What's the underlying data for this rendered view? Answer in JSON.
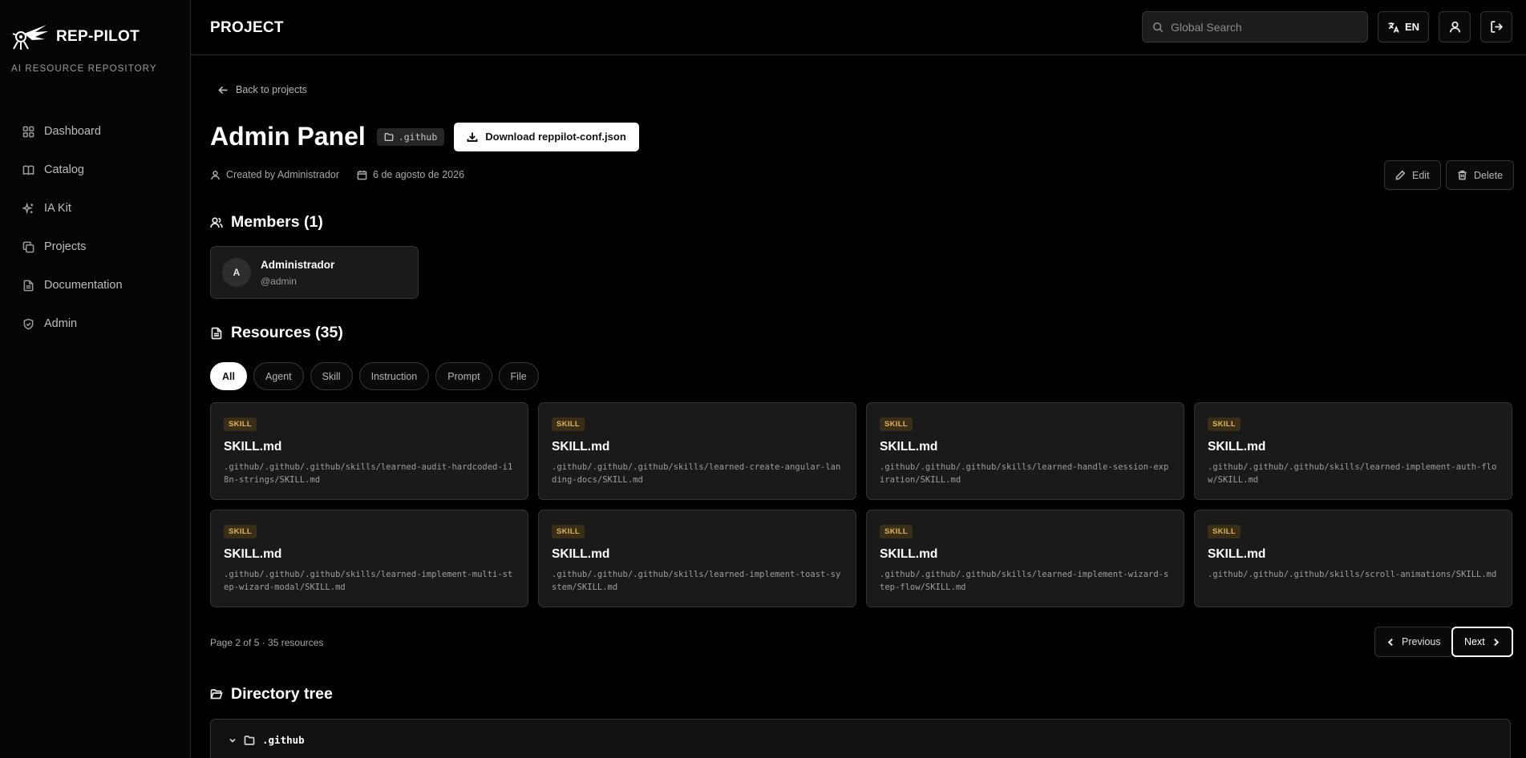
{
  "brand": {
    "name": "REP-PILOT",
    "subtitle": "AI RESOURCE REPOSITORY"
  },
  "sidebar": {
    "items": [
      {
        "label": "Dashboard",
        "icon": "grid-icon"
      },
      {
        "label": "Catalog",
        "icon": "book-icon"
      },
      {
        "label": "IA Kit",
        "icon": "sparkles-icon"
      },
      {
        "label": "Projects",
        "icon": "copy-icon"
      },
      {
        "label": "Documentation",
        "icon": "file-text-icon"
      },
      {
        "label": "Admin",
        "icon": "shield-icon"
      }
    ]
  },
  "header": {
    "title": "PROJECT",
    "search_placeholder": "Global Search",
    "lang": "EN"
  },
  "project": {
    "back_label": "Back to projects",
    "name": "Admin Panel",
    "path": ".github",
    "download_label": "Download reppilot-conf.json",
    "created_by": "Created by Administrador",
    "date": "6 de agosto de 2026",
    "edit_label": "Edit",
    "delete_label": "Delete"
  },
  "members": {
    "heading": "Members (1)",
    "list": [
      {
        "initial": "A",
        "name": "Administrador",
        "handle": "@admin"
      }
    ]
  },
  "resources": {
    "heading": "Resources (35)",
    "filters": [
      "All",
      "Agent",
      "Skill",
      "Instruction",
      "Prompt",
      "File"
    ],
    "active_filter": "All",
    "items": [
      {
        "type": "SKILL",
        "title": "SKILL.md",
        "path": ".github/.github/.github/skills/learned-audit-hardcoded-i18n-strings/SKILL.md"
      },
      {
        "type": "SKILL",
        "title": "SKILL.md",
        "path": ".github/.github/.github/skills/learned-create-angular-landing-docs/SKILL.md"
      },
      {
        "type": "SKILL",
        "title": "SKILL.md",
        "path": ".github/.github/.github/skills/learned-handle-session-expiration/SKILL.md"
      },
      {
        "type": "SKILL",
        "title": "SKILL.md",
        "path": ".github/.github/.github/skills/learned-implement-auth-flow/SKILL.md"
      },
      {
        "type": "SKILL",
        "title": "SKILL.md",
        "path": ".github/.github/.github/skills/learned-implement-multi-step-wizard-modal/SKILL.md"
      },
      {
        "type": "SKILL",
        "title": "SKILL.md",
        "path": ".github/.github/.github/skills/learned-implement-toast-system/SKILL.md"
      },
      {
        "type": "SKILL",
        "title": "SKILL.md",
        "path": ".github/.github/.github/skills/learned-implement-wizard-step-flow/SKILL.md"
      },
      {
        "type": "SKILL",
        "title": "SKILL.md",
        "path": ".github/.github/.github/skills/scroll-animations/SKILL.md"
      }
    ],
    "page_info": "Page 2 of 5 · 35 resources",
    "previous_label": "Previous",
    "next_label": "Next"
  },
  "tree": {
    "heading": "Directory tree",
    "root": ".github"
  }
}
